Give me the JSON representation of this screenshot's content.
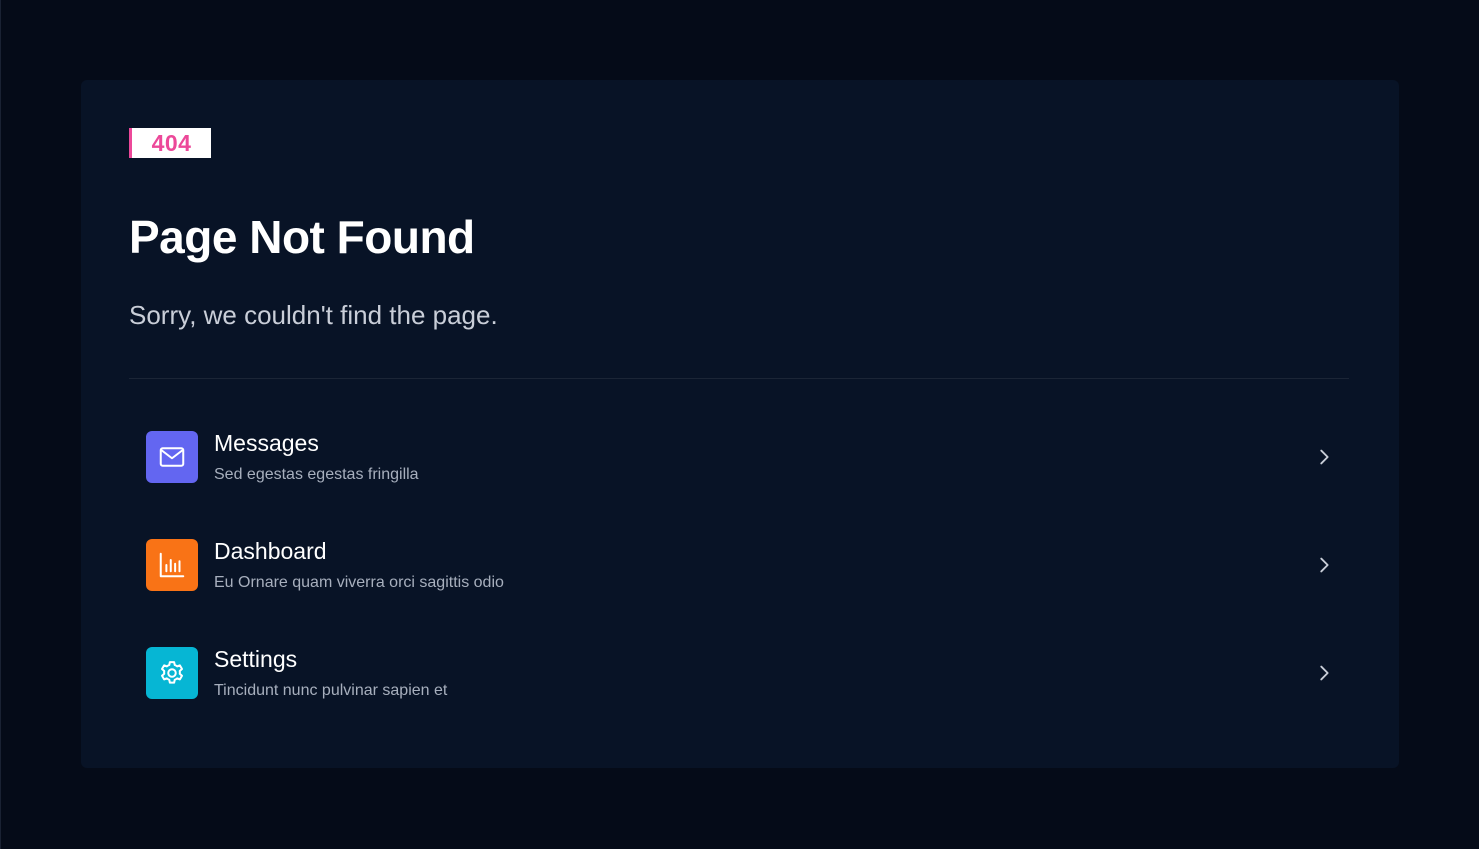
{
  "colors": {
    "background": "#050b18",
    "card": "#081326",
    "badge_accent": "#ec4899",
    "messages_icon_bg": "#6366f1",
    "dashboard_icon_bg": "#f97316",
    "settings_icon_bg": "#06b6d4"
  },
  "error": {
    "code": "404",
    "title": "Page Not Found",
    "message": "Sorry, we couldn't find the page."
  },
  "links": [
    {
      "title": "Messages",
      "description": "Sed egestas egestas fringilla",
      "icon": "envelope-icon"
    },
    {
      "title": "Dashboard",
      "description": "Eu Ornare quam viverra orci sagittis odio",
      "icon": "chart-bar-icon"
    },
    {
      "title": "Settings",
      "description": "Tincidunt nunc pulvinar sapien et",
      "icon": "gear-icon"
    }
  ]
}
